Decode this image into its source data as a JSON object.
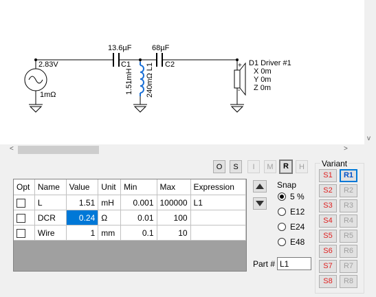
{
  "schematic": {
    "source_voltage": "2.83V",
    "source_resistance": "1mΩ",
    "c1_value": "13.6µF",
    "c1_name": "C1",
    "l1_value": "1.51mH",
    "l1_dcr": "240mΩ L1",
    "c2_value": "68µF",
    "c2_name": "C2",
    "driver_name": "D1 Driver #1",
    "driver_x": "X 0m",
    "driver_y": "Y 0m",
    "driver_z": "Z 0m",
    "plus": "+",
    "minus": "-"
  },
  "scrollbars": {
    "left": "<",
    "right": ">",
    "down": "v"
  },
  "toolbar": {
    "o": "O",
    "s": "S",
    "i": "I",
    "m": "M",
    "r": "R",
    "h": "H"
  },
  "grid": {
    "headers": [
      "Opt",
      "Name",
      "Value",
      "Unit",
      "Min",
      "Max",
      "Expression"
    ],
    "rows": [
      {
        "name": "L",
        "value": "1.51",
        "unit": "mH",
        "min": "0.001",
        "max": "100000",
        "expr": "L1"
      },
      {
        "name": "DCR",
        "value": "0.24",
        "unit": "Ω",
        "min": "0.01",
        "max": "100",
        "expr": ""
      },
      {
        "name": "Wire",
        "value": "1",
        "unit": "mm",
        "min": "0.1",
        "max": "10",
        "expr": ""
      }
    ]
  },
  "snap": {
    "title": "Snap",
    "options": [
      "5 %",
      "E12",
      "E24",
      "E48"
    ],
    "selected": "5 %"
  },
  "part": {
    "label": "Part #",
    "value": "L1"
  },
  "variant": {
    "title": "Variant",
    "s": [
      "S1",
      "S2",
      "S3",
      "S4",
      "S5",
      "S6",
      "S7",
      "S8"
    ],
    "r": [
      "R1",
      "R2",
      "R3",
      "R4",
      "R5",
      "R6",
      "R7",
      "R8"
    ],
    "active": "R1"
  }
}
